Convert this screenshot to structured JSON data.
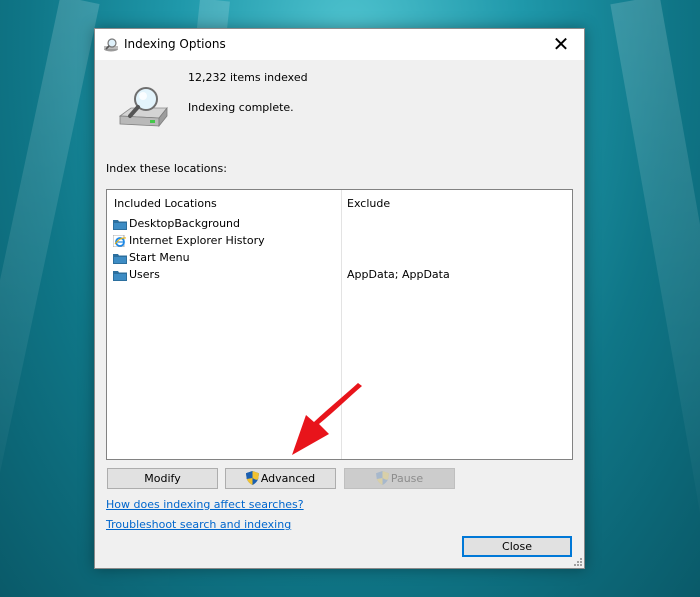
{
  "window": {
    "title": "Indexing Options",
    "close_glyph": "✕"
  },
  "status": {
    "items_indexed": "12,232 items indexed",
    "state": "Indexing complete."
  },
  "locations_label": "Index these locations:",
  "table": {
    "col_included": "Included Locations",
    "col_exclude": "Exclude",
    "rows": [
      {
        "name": "DesktopBackground",
        "icon": "folder-icon",
        "exclude": ""
      },
      {
        "name": "Internet Explorer History",
        "icon": "ie-icon",
        "exclude": ""
      },
      {
        "name": "Start Menu",
        "icon": "folder-icon",
        "exclude": ""
      },
      {
        "name": "Users",
        "icon": "folder-icon",
        "exclude": "AppData; AppData"
      }
    ]
  },
  "buttons": {
    "modify": "Modify",
    "advanced": "Advanced",
    "pause": "Pause",
    "close": "Close"
  },
  "links": {
    "affect": "How does indexing affect searches?",
    "troubleshoot": "Troubleshoot search and indexing"
  },
  "colors": {
    "link": "#0066cc",
    "accent": "#0078d7",
    "arrow": "#e8141b"
  }
}
